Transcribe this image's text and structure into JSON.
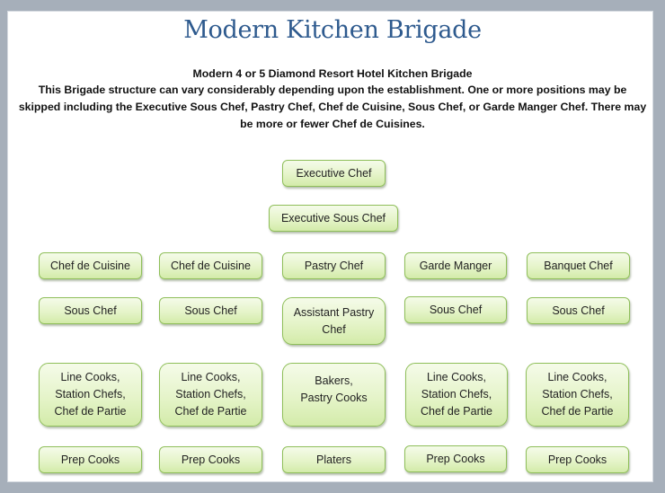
{
  "page": {
    "title": "Modern Kitchen Brigade",
    "subtitle": "Modern 4 or 5 Diamond Resort Hotel Kitchen Brigade",
    "description": "This Brigade structure can vary considerably depending upon the establishment. One or more positions may be skipped including the Executive Sous Chef, Pastry Chef, Chef de Cuisine, Sous Chef, or Garde Manger Chef. There may be more or fewer Chef de Cuisines."
  },
  "colors": {
    "title": "#2e5a8e",
    "box_fill": "#e5f4c9",
    "box_border": "#8fbf5a",
    "frame": "#a6afba"
  },
  "hierarchy": {
    "executive_chef": "Executive Chef",
    "executive_sous_chef": "Executive Sous Chef",
    "columns": [
      {
        "head": "Chef de Cuisine",
        "second": "Sous Chef",
        "third": "Line Cooks,\nStation Chefs,\nChef de Partie",
        "fourth": "Prep Cooks"
      },
      {
        "head": "Chef de Cuisine",
        "second": "Sous Chef",
        "third": "Line Cooks,\nStation Chefs,\nChef de Partie",
        "fourth": "Prep Cooks"
      },
      {
        "head": "Pastry Chef",
        "second": "Assistant Pastry\nChef",
        "third": "Bakers,\nPastry Cooks",
        "fourth": "Platers"
      },
      {
        "head": "Garde Manger",
        "second": "Sous Chef",
        "third": "Line Cooks,\nStation Chefs,\nChef de Partie",
        "fourth": "Prep Cooks"
      },
      {
        "head": "Banquet Chef",
        "second": "Sous Chef",
        "third": "Line Cooks,\nStation Chefs,\nChef de Partie",
        "fourth": "Prep Cooks"
      }
    ]
  }
}
